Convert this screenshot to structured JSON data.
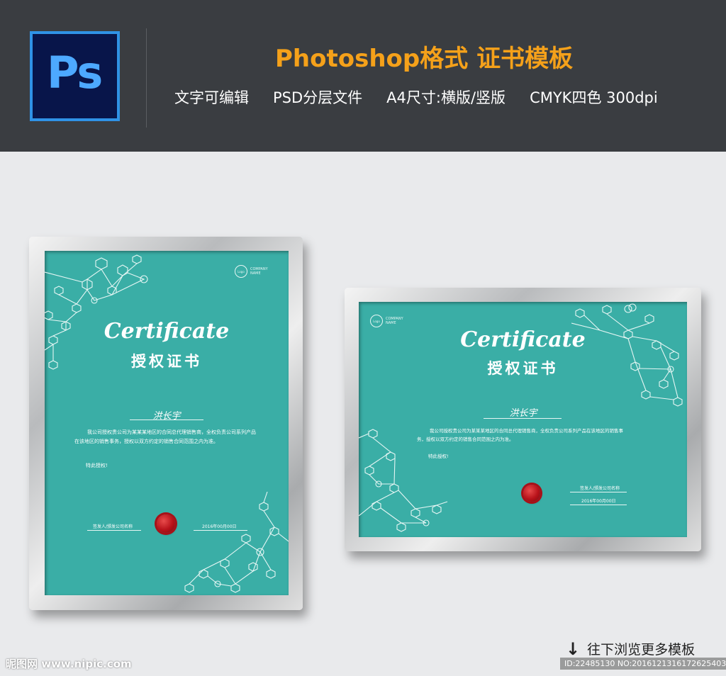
{
  "header": {
    "logo_text": "Ps",
    "title": "Photoshop格式  证书模板",
    "features": [
      "文字可编辑",
      "PSD分层文件",
      "A4尺寸:横版/竖版",
      "CMYK四色 300dpi"
    ]
  },
  "certificate": {
    "logo_label": "Logo",
    "company_name": "COMPANY NAME",
    "title_en": "Certificate",
    "title_cn": "授权证书",
    "recipient": "洪长宇",
    "body": "我公司授权贵公司为某某某地区的合同总代理销售商，全权负责公司系列产品在该地区的销售事务，授权以双方约定的销售合同范围之内为准。",
    "body_landscape": "我公司授权贵公司为某某某地区的合同总代理销售商，全权负责公司系列产品在该地区的销售事务，授权以双方约定的销售合同范围之内为准。",
    "special": "特此授权!",
    "issuer": "签发人/颁发公司名称",
    "date": "2016年00月00日"
  },
  "footer": {
    "browse_label": "往下浏览更多模板",
    "watermark": "昵图网 www.nipic.com",
    "id_text": "ID:22485130 NO:20161213161726254032"
  },
  "colors": {
    "header_bg": "#3a3d41",
    "title_accent": "#f5a11a",
    "certificate_teal": "#3aaea6",
    "seal_red": "#b8121a"
  }
}
